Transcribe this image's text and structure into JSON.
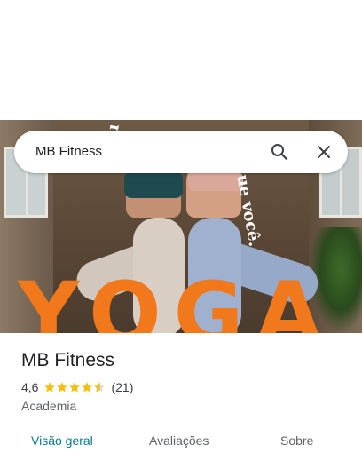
{
  "search": {
    "value": "MB Fitness"
  },
  "icons": {
    "search": "search-icon",
    "close": "close-icon",
    "star": "star-icon"
  },
  "hero_image": {
    "overlay_text": "YOGA",
    "curved_text_left": "Escu",
    "curved_text_right": "ue você."
  },
  "place": {
    "name": "MB Fitness",
    "rating": "4,6",
    "rating_value": 4.6,
    "reviews_count": "(21)",
    "category": "Academia"
  },
  "tabs": [
    {
      "label": "Visão geral",
      "active": true
    },
    {
      "label": "Avaliações",
      "active": false
    },
    {
      "label": "Sobre",
      "active": false
    }
  ],
  "colors": {
    "accent": "#0b7a8f",
    "star": "#fbbc04",
    "yoga_text": "#f2781c"
  }
}
